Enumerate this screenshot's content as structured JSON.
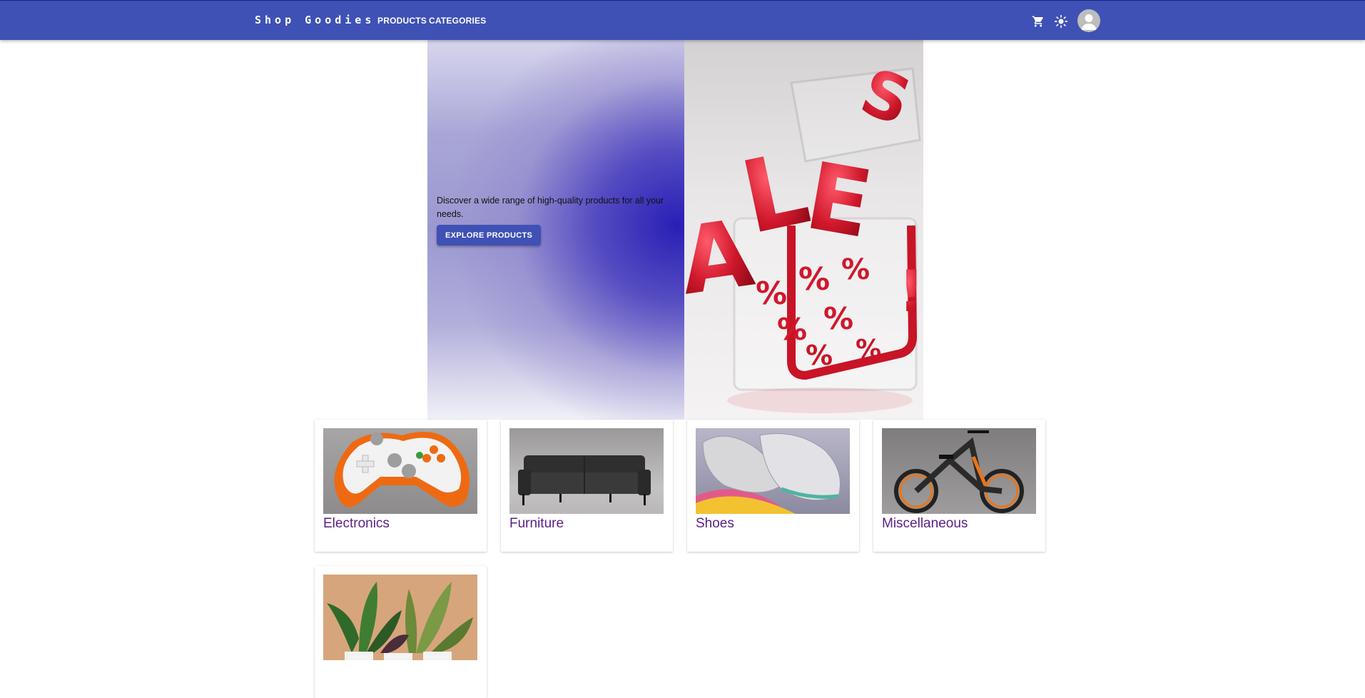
{
  "header": {
    "brand": "Shop Goodies",
    "nav": [
      {
        "label": "PRODUCTS"
      },
      {
        "label": "CATEGORIES"
      }
    ],
    "icons": [
      "cart-icon",
      "sun-icon",
      "account-icon"
    ],
    "bar_color": "#3f51b5"
  },
  "hero": {
    "text": "Discover a wide range of high-quality products for all your needs.",
    "cta_label": "EXPLORE PRODUCTS",
    "image_text": "SALE"
  },
  "categories": [
    {
      "label": "Electronics"
    },
    {
      "label": "Furniture"
    },
    {
      "label": "Shoes"
    },
    {
      "label": "Miscellaneous"
    },
    {
      "label": ""
    }
  ],
  "colors": {
    "primary": "#3f51b5",
    "category_link": "#5b1e8a",
    "sale_red": "#d0182c"
  }
}
